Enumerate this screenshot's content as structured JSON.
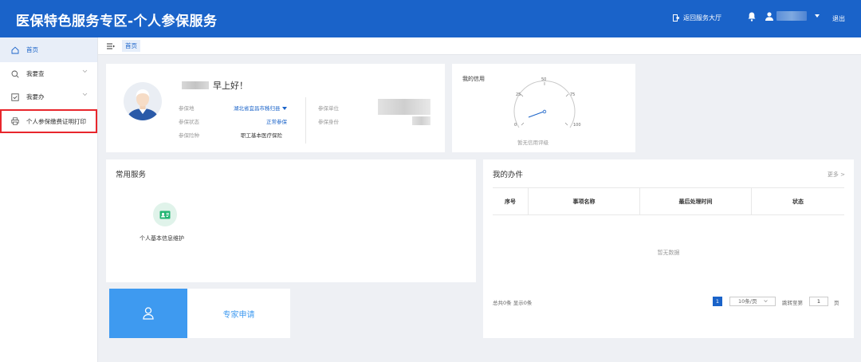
{
  "header": {
    "title": "医保特色服务专区-个人参保服务",
    "return_hall": "返回服务大厅",
    "logout": "退出"
  },
  "sidebar": {
    "items": [
      {
        "label": "首页",
        "icon": "home-icon"
      },
      {
        "label": "我要查",
        "icon": "search-icon"
      },
      {
        "label": "我要办",
        "icon": "check-box-icon"
      },
      {
        "label": "个人参保缴费证明打印",
        "icon": "printer-icon"
      }
    ]
  },
  "breadcrumb": {
    "current": "首页"
  },
  "profile": {
    "greeting": "早上好！",
    "labels": {
      "place": "参保地",
      "status": "参保状态",
      "insurance_type": "参保险种",
      "unit": "参保单位",
      "identity": "参保身份"
    },
    "values": {
      "place": "湖北省宜昌市秭归县",
      "status": "正常参保",
      "insurance_type": "职工基本医疗保险"
    }
  },
  "credit": {
    "title": "我的信用",
    "gauge_ticks": [
      "0",
      "25",
      "50",
      "75",
      "100"
    ],
    "no_rating": "暂无信用评级"
  },
  "services": {
    "title": "常用服务",
    "items": [
      {
        "label": "个人基本信息维护",
        "icon": "id-card-icon"
      }
    ]
  },
  "expert": {
    "label": "专家申请",
    "icon": "user-icon"
  },
  "tasks": {
    "title": "我的办件",
    "more": "更多 >",
    "columns": [
      "序号",
      "事项名称",
      "最后处理时间",
      "状态"
    ],
    "empty": "暂无数据",
    "pager": {
      "total": "总共0条 显示0条",
      "current_page": "1",
      "page_size": "10条/页",
      "jump_to": "跳转至第",
      "jump_value": "1",
      "page_unit": "页"
    }
  },
  "colors": {
    "primary": "#1a63c9",
    "accent": "#3e9af0",
    "highlight": "#e8262c"
  }
}
